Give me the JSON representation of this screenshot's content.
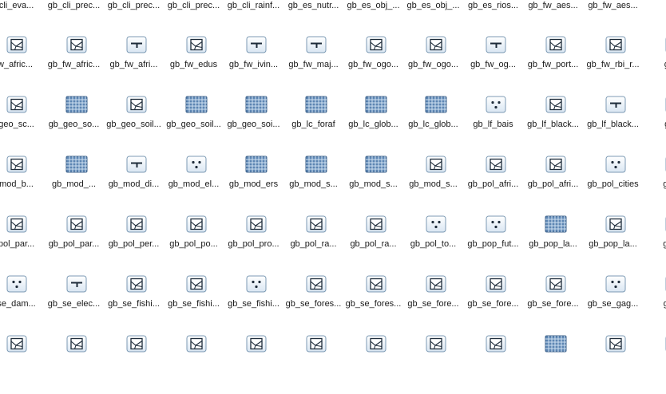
{
  "rows": [
    {
      "items": [
        {
          "label": "_cli_eva...",
          "icon": "none"
        },
        {
          "label": "gb_cli_prec...",
          "icon": "none"
        },
        {
          "label": "gb_cli_prec...",
          "icon": "none"
        },
        {
          "label": "gb_cli_prec...",
          "icon": "none"
        },
        {
          "label": "gb_cli_rainf...",
          "icon": "none"
        },
        {
          "label": "gb_es_nutr...",
          "icon": "none"
        },
        {
          "label": "gb_es_obj_...",
          "icon": "none"
        },
        {
          "label": "gb_es_obj_...",
          "icon": "none"
        },
        {
          "label": "gb_es_rios...",
          "icon": "none"
        },
        {
          "label": "gb_fw_aes...",
          "icon": "none"
        },
        {
          "label": "gb_fw_aes...",
          "icon": "none"
        },
        {
          "label": "",
          "icon": "none"
        }
      ]
    },
    {
      "items": [
        {
          "label": "fw_afric...",
          "icon": "polygon-shapefile-icon"
        },
        {
          "label": "gb_fw_afric...",
          "icon": "polygon-shapefile-icon"
        },
        {
          "label": "gb_fw_afri...",
          "icon": "line-shapefile-icon"
        },
        {
          "label": "gb_fw_edus",
          "icon": "polygon-shapefile-icon"
        },
        {
          "label": "gb_fw_ivin...",
          "icon": "line-shapefile-icon"
        },
        {
          "label": "gb_fw_maj...",
          "icon": "line-shapefile-icon"
        },
        {
          "label": "gb_fw_ogo...",
          "icon": "polygon-shapefile-icon"
        },
        {
          "label": "gb_fw_ogo...",
          "icon": "polygon-shapefile-icon"
        },
        {
          "label": "gb_fw_og...",
          "icon": "line-shapefile-icon"
        },
        {
          "label": "gb_fw_port...",
          "icon": "polygon-shapefile-icon"
        },
        {
          "label": "gb_fw_rbi_r...",
          "icon": "polygon-shapefile-icon"
        },
        {
          "label": "gb_f",
          "icon": "polygon-shapefile-icon"
        }
      ]
    },
    {
      "items": [
        {
          "label": "_geo_sc...",
          "icon": "polygon-shapefile-icon"
        },
        {
          "label": "gb_geo_so...",
          "icon": "raster-icon"
        },
        {
          "label": "gb_geo_soil...",
          "icon": "polygon-shapefile-icon"
        },
        {
          "label": "gb_geo_soil...",
          "icon": "raster-icon"
        },
        {
          "label": "gb_geo_soi...",
          "icon": "raster-icon"
        },
        {
          "label": "gb_lc_foraf",
          "icon": "raster-icon"
        },
        {
          "label": "gb_lc_glob...",
          "icon": "raster-icon"
        },
        {
          "label": "gb_lc_glob...",
          "icon": "raster-icon"
        },
        {
          "label": "gb_lf_bais",
          "icon": "point-shapefile-icon"
        },
        {
          "label": "gb_lf_black...",
          "icon": "polygon-shapefile-icon"
        },
        {
          "label": "gb_lf_black...",
          "icon": "line-shapefile-icon"
        },
        {
          "label": "gb_l",
          "icon": "polygon-shapefile-icon"
        }
      ]
    },
    {
      "items": [
        {
          "label": "_mod_b...",
          "icon": "polygon-shapefile-icon"
        },
        {
          "label": "gb_mod_...",
          "icon": "raster-icon"
        },
        {
          "label": "gb_mod_di...",
          "icon": "line-shapefile-icon"
        },
        {
          "label": "gb_mod_el...",
          "icon": "point-shapefile-icon"
        },
        {
          "label": "gb_mod_ers",
          "icon": "raster-icon"
        },
        {
          "label": "gb_mod_s...",
          "icon": "raster-icon"
        },
        {
          "label": "gb_mod_s...",
          "icon": "raster-icon"
        },
        {
          "label": "gb_mod_s...",
          "icon": "polygon-shapefile-icon"
        },
        {
          "label": "gb_pol_afri...",
          "icon": "polygon-shapefile-icon"
        },
        {
          "label": "gb_pol_afri...",
          "icon": "polygon-shapefile-icon"
        },
        {
          "label": "gb_pol_cities",
          "icon": "point-shapefile-icon"
        },
        {
          "label": "gb_p",
          "icon": "polygon-shapefile-icon"
        }
      ]
    },
    {
      "items": [
        {
          "label": "_pol_par...",
          "icon": "polygon-shapefile-icon"
        },
        {
          "label": "gb_pol_par...",
          "icon": "polygon-shapefile-icon"
        },
        {
          "label": "gb_pol_per...",
          "icon": "polygon-shapefile-icon"
        },
        {
          "label": "gb_pol_po...",
          "icon": "polygon-shapefile-icon"
        },
        {
          "label": "gb_pol_pro...",
          "icon": "polygon-shapefile-icon"
        },
        {
          "label": "gb_pol_ra...",
          "icon": "polygon-shapefile-icon"
        },
        {
          "label": "gb_pol_ra...",
          "icon": "polygon-shapefile-icon"
        },
        {
          "label": "gb_pol_to...",
          "icon": "point-shapefile-icon"
        },
        {
          "label": "gb_pop_fut...",
          "icon": "point-shapefile-icon"
        },
        {
          "label": "gb_pop_la...",
          "icon": "raster-icon"
        },
        {
          "label": "gb_pop_la...",
          "icon": "polygon-shapefile-icon"
        },
        {
          "label": "gb_p",
          "icon": "polygon-shapefile-icon"
        }
      ]
    },
    {
      "items": [
        {
          "label": "_se_dam...",
          "icon": "point-shapefile-icon"
        },
        {
          "label": "gb_se_elec...",
          "icon": "line-shapefile-icon"
        },
        {
          "label": "gb_se_fishi...",
          "icon": "polygon-shapefile-icon"
        },
        {
          "label": "gb_se_fishi...",
          "icon": "polygon-shapefile-icon"
        },
        {
          "label": "gb_se_fishi...",
          "icon": "point-shapefile-icon"
        },
        {
          "label": "gb_se_fores...",
          "icon": "polygon-shapefile-icon"
        },
        {
          "label": "gb_se_fores...",
          "icon": "polygon-shapefile-icon"
        },
        {
          "label": "gb_se_fore...",
          "icon": "polygon-shapefile-icon"
        },
        {
          "label": "gb_se_fore...",
          "icon": "polygon-shapefile-icon"
        },
        {
          "label": "gb_se_fore...",
          "icon": "polygon-shapefile-icon"
        },
        {
          "label": "gb_se_gag...",
          "icon": "point-shapefile-icon"
        },
        {
          "label": "gb_s",
          "icon": "polygon-shapefile-icon"
        }
      ]
    },
    {
      "items": [
        {
          "label": "",
          "icon": "polygon-shapefile-icon"
        },
        {
          "label": "",
          "icon": "polygon-shapefile-icon"
        },
        {
          "label": "",
          "icon": "polygon-shapefile-icon"
        },
        {
          "label": "",
          "icon": "polygon-shapefile-icon"
        },
        {
          "label": "",
          "icon": "polygon-shapefile-icon"
        },
        {
          "label": "",
          "icon": "polygon-shapefile-icon"
        },
        {
          "label": "",
          "icon": "polygon-shapefile-icon"
        },
        {
          "label": "",
          "icon": "polygon-shapefile-icon"
        },
        {
          "label": "",
          "icon": "polygon-shapefile-icon"
        },
        {
          "label": "",
          "icon": "raster-icon"
        },
        {
          "label": "",
          "icon": "polygon-shapefile-icon"
        },
        {
          "label": "",
          "icon": "polygon-shapefile-icon"
        }
      ]
    }
  ]
}
